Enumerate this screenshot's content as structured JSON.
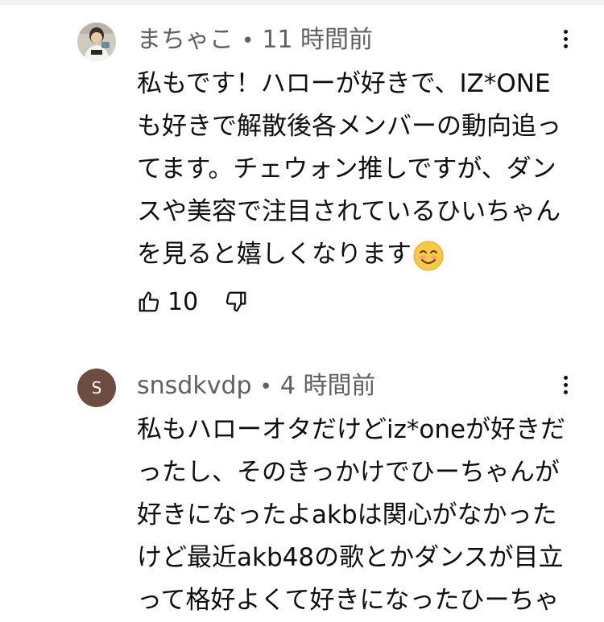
{
  "comments": [
    {
      "author": "まちゃこ",
      "separator": "•",
      "time": "11 時間前",
      "avatar": "photo-avatar",
      "text": "私もです！ハローが好きで、IZ*ONE\nも好きで解散後各メンバーの動向追っ\nてます。チェウォン推しですが、ダン\nスや美容で注目されているひいちゃん\nを見ると嬉しくなります",
      "emoji": "smiling-face-emoji",
      "likes": "10"
    },
    {
      "author": "snsdkvdp",
      "separator": "•",
      "time": "4 時間前",
      "avatar_letter": "S",
      "avatar_color": "#6d4c41",
      "text": "私もハローオタだけどiz*oneが好きだ\nったし、そのきっかけでひーちゃんが\n好きになったよakbは関心がなかった\nけど最近akb48の歌とかダンスが目立\nって格好よくて好きになったひーちゃ"
    }
  ],
  "icons": {
    "more": "more-vert-icon",
    "like": "thumbs-up-icon",
    "dislike": "thumbs-down-icon"
  }
}
